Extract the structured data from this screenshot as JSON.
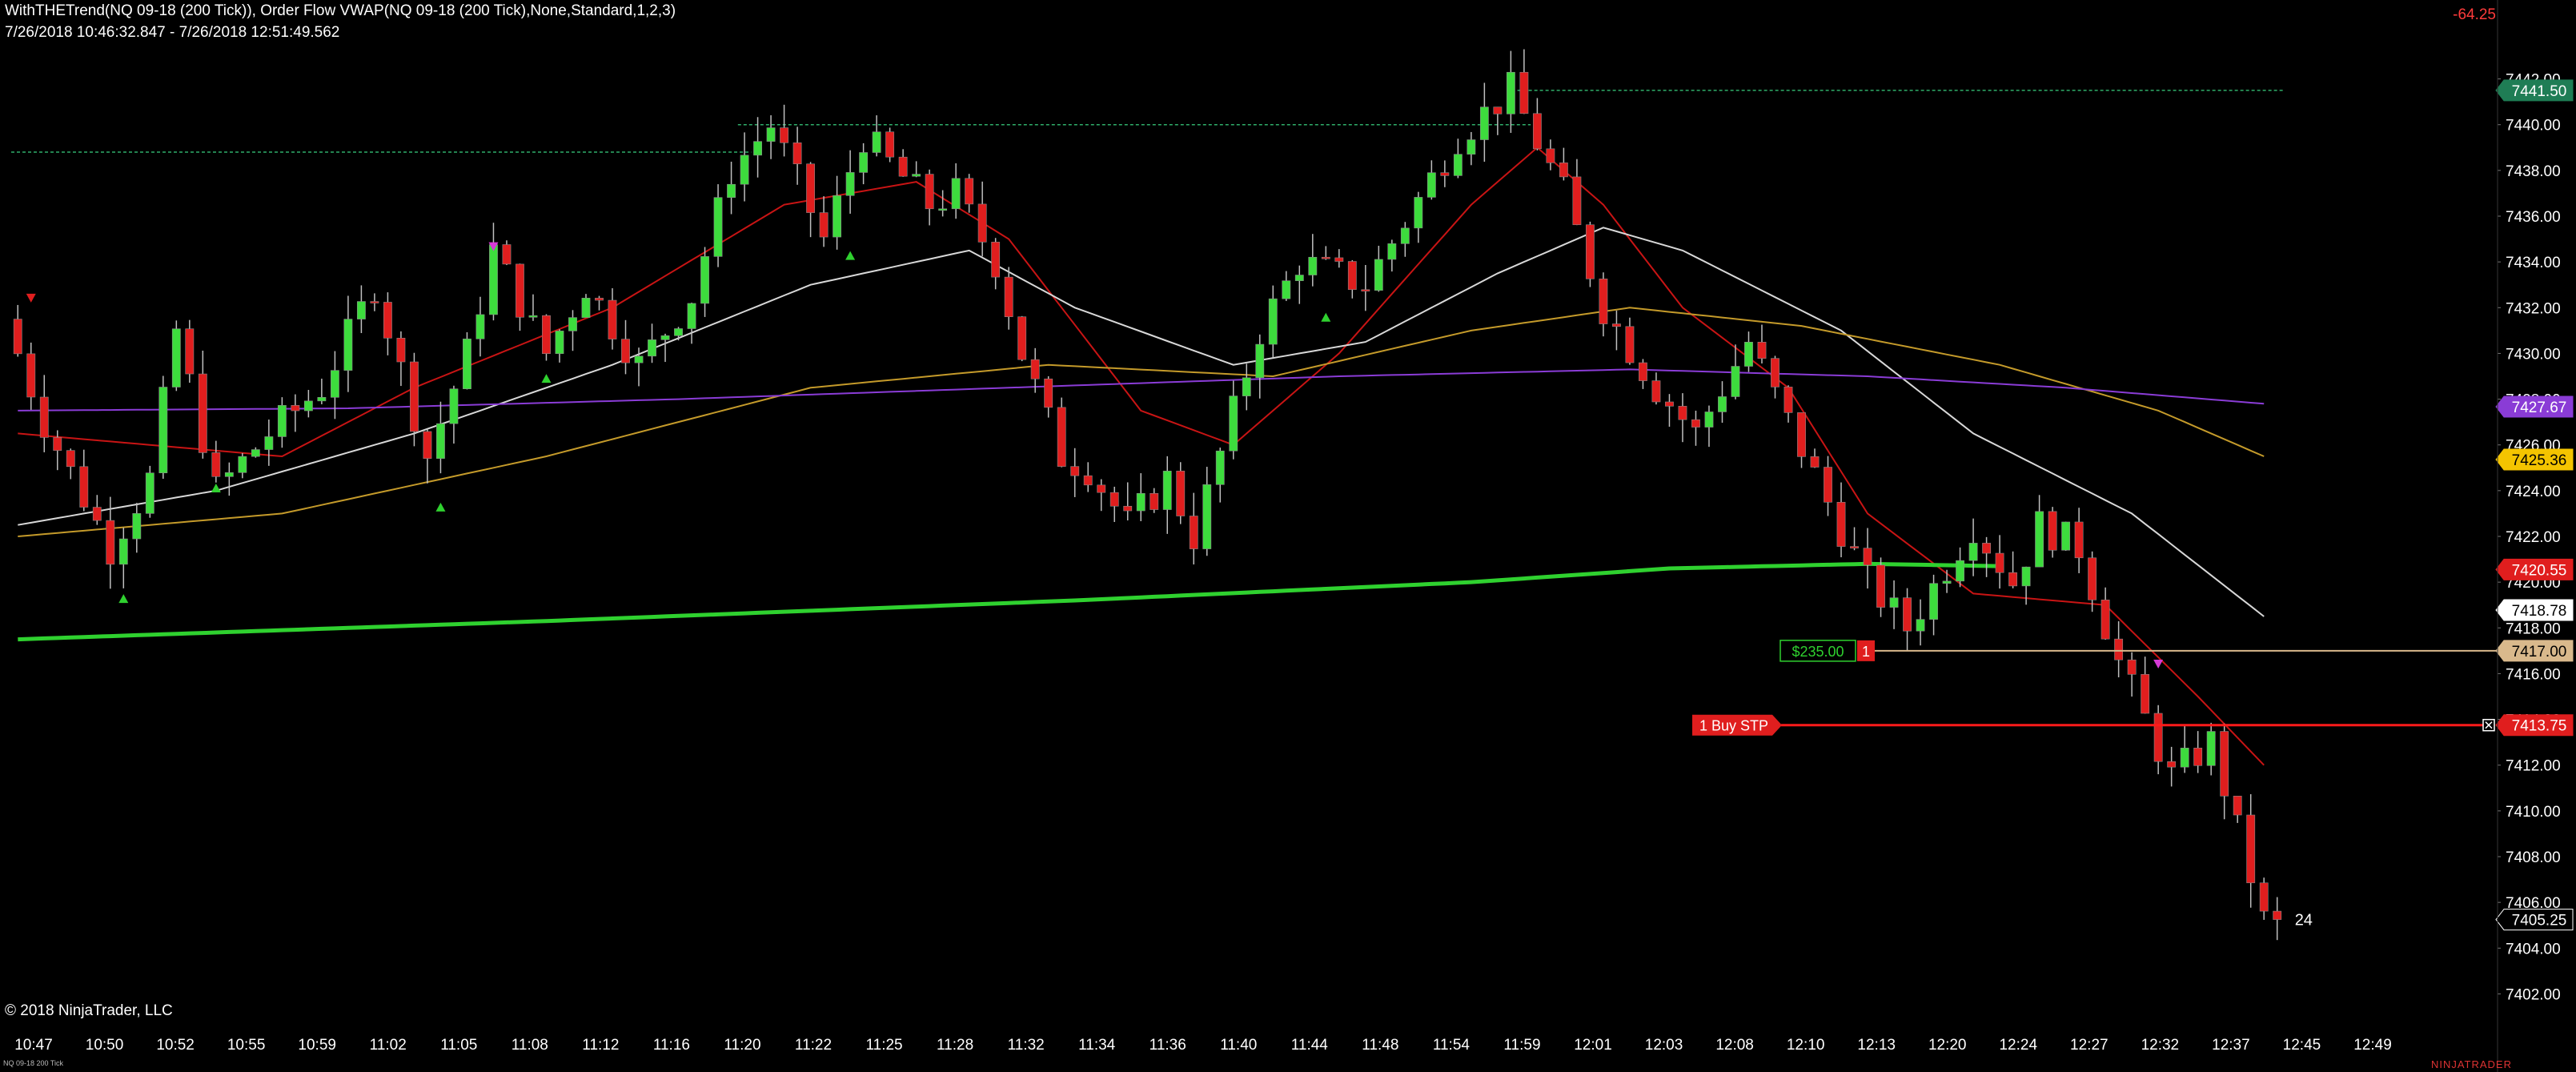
{
  "header": {
    "title": "WithTHETrend(NQ 09-18 (200 Tick)), Order Flow VWAP(NQ 09-18 (200 Tick),None,Standard,1,2,3)",
    "date_range": "7/26/2018 10:46:32.847 - 7/26/2018 12:51:49.562",
    "pnl": "-64.25"
  },
  "footer": {
    "copyright": "© 2018 NinjaTrader, LLC",
    "instrument_tag": "NQ 09-18 200 Tick",
    "brand": "NINJATRADER"
  },
  "colors": {
    "background": "#000000",
    "up_candle": "#3ddc3d",
    "down_candle": "#e01e1e",
    "ema_fast": "#c81414",
    "ema_mid": "#d8d8d8",
    "ema_slow": "#c49a2a",
    "sma_long": "#8a3cd6",
    "vwap": "#2fd12f",
    "position_line": "#d9b98c",
    "stop_line": "#ff1a1a"
  },
  "chart_data": {
    "type": "candlestick",
    "y_range": [
      7401,
      7443
    ],
    "y_ticks": [
      "7442.00",
      "7440.00",
      "7438.00",
      "7436.00",
      "7434.00",
      "7432.00",
      "7430.00",
      "7428.00",
      "7426.00",
      "7424.00",
      "7422.00",
      "7420.00",
      "7418.00",
      "7416.00",
      "7414.00",
      "7412.00",
      "7410.00",
      "7408.00",
      "7406.00",
      "7404.00",
      "7402.00"
    ],
    "x_labels": [
      "10:47",
      "10:50",
      "10:52",
      "10:55",
      "10:59",
      "11:02",
      "11:05",
      "11:08",
      "11:12",
      "11:16",
      "11:20",
      "11:22",
      "11:25",
      "11:28",
      "11:32",
      "11:34",
      "11:36",
      "11:40",
      "11:44",
      "11:48",
      "11:54",
      "11:59",
      "12:01",
      "12:03",
      "12:08",
      "12:10",
      "12:13",
      "12:20",
      "12:24",
      "12:27",
      "12:32",
      "12:37",
      "12:45",
      "12:49"
    ],
    "bar_count": 180,
    "waypoints": [
      [
        0,
        7431.5
      ],
      [
        3,
        7427.0
      ],
      [
        8,
        7421.5
      ],
      [
        11,
        7424.5
      ],
      [
        13,
        7431.0
      ],
      [
        16,
        7424.0
      ],
      [
        20,
        7426.5
      ],
      [
        24,
        7428.5
      ],
      [
        28,
        7433.0
      ],
      [
        32,
        7425.5
      ],
      [
        35,
        7430.0
      ],
      [
        37,
        7434.5
      ],
      [
        41,
        7430.0
      ],
      [
        44,
        7433.0
      ],
      [
        48,
        7429.5
      ],
      [
        52,
        7432.5
      ],
      [
        55,
        7438.0
      ],
      [
        58,
        7440.0
      ],
      [
        62,
        7435.0
      ],
      [
        65,
        7439.5
      ],
      [
        70,
        7436.5
      ],
      [
        72,
        7437.0
      ],
      [
        75,
        7434.0
      ],
      [
        77,
        7430.0
      ],
      [
        80,
        7425.5
      ],
      [
        82,
        7425.0
      ],
      [
        85,
        7422.5
      ],
      [
        88,
        7424.5
      ],
      [
        90,
        7422.0
      ],
      [
        95,
        7431.0
      ],
      [
        98,
        7434.0
      ],
      [
        103,
        7433.0
      ],
      [
        110,
        7439.5
      ],
      [
        114,
        7441.5
      ],
      [
        118,
        7437.0
      ],
      [
        121,
        7432.0
      ],
      [
        125,
        7428.5
      ],
      [
        128,
        7426.5
      ],
      [
        132,
        7430.5
      ],
      [
        135,
        7427.0
      ],
      [
        138,
        7423.5
      ],
      [
        141,
        7420.0
      ],
      [
        144,
        7418.0
      ],
      [
        149,
        7422.5
      ],
      [
        152,
        7420.0
      ],
      [
        154,
        7422.5
      ],
      [
        157,
        7421.5
      ],
      [
        160,
        7416.5
      ],
      [
        164,
        7411.5
      ],
      [
        167,
        7413.0
      ],
      [
        171,
        7405.2
      ]
    ],
    "series": [
      {
        "name": "EMA fast",
        "color": "#c81414",
        "points": [
          [
            0,
            7426.5
          ],
          [
            20,
            7425.5
          ],
          [
            30,
            7428.5
          ],
          [
            45,
            7432.0
          ],
          [
            58,
            7436.5
          ],
          [
            68,
            7437.5
          ],
          [
            75,
            7435.0
          ],
          [
            85,
            7427.5
          ],
          [
            92,
            7426.0
          ],
          [
            100,
            7430.0
          ],
          [
            110,
            7436.5
          ],
          [
            115,
            7439.0
          ],
          [
            120,
            7436.5
          ],
          [
            126,
            7432.0
          ],
          [
            134,
            7428.5
          ],
          [
            140,
            7423.0
          ],
          [
            148,
            7419.5
          ],
          [
            158,
            7419.0
          ],
          [
            165,
            7415.0
          ],
          [
            170,
            7412.0
          ]
        ]
      },
      {
        "name": "EMA mid",
        "color": "#d8d8d8",
        "points": [
          [
            0,
            7422.5
          ],
          [
            15,
            7424.0
          ],
          [
            30,
            7426.5
          ],
          [
            45,
            7429.5
          ],
          [
            60,
            7433.0
          ],
          [
            72,
            7434.5
          ],
          [
            80,
            7432.0
          ],
          [
            92,
            7429.5
          ],
          [
            102,
            7430.5
          ],
          [
            112,
            7433.5
          ],
          [
            120,
            7435.5
          ],
          [
            126,
            7434.5
          ],
          [
            138,
            7431.0
          ],
          [
            148,
            7426.5
          ],
          [
            160,
            7423.0
          ],
          [
            170,
            7418.5
          ]
        ]
      },
      {
        "name": "EMA slow",
        "color": "#c49a2a",
        "points": [
          [
            0,
            7422.0
          ],
          [
            20,
            7423.0
          ],
          [
            40,
            7425.5
          ],
          [
            60,
            7428.5
          ],
          [
            78,
            7429.5
          ],
          [
            95,
            7429.0
          ],
          [
            110,
            7431.0
          ],
          [
            122,
            7432.0
          ],
          [
            135,
            7431.2
          ],
          [
            150,
            7429.5
          ],
          [
            162,
            7427.5
          ],
          [
            170,
            7425.5
          ]
        ]
      },
      {
        "name": "SMA long",
        "color": "#8a3cd6",
        "points": [
          [
            0,
            7427.5
          ],
          [
            25,
            7427.6
          ],
          [
            50,
            7428.0
          ],
          [
            75,
            7428.5
          ],
          [
            100,
            7429.0
          ],
          [
            122,
            7429.3
          ],
          [
            140,
            7429.0
          ],
          [
            155,
            7428.5
          ],
          [
            170,
            7427.8
          ]
        ]
      },
      {
        "name": "VWAP",
        "color": "#2fd12f",
        "points": [
          [
            0,
            7417.5
          ],
          [
            40,
            7418.3
          ],
          [
            80,
            7419.2
          ],
          [
            110,
            7420.0
          ],
          [
            125,
            7420.6
          ],
          [
            140,
            7420.8
          ],
          [
            150,
            7420.7
          ]
        ]
      }
    ],
    "horizontal_levels": [
      {
        "value": 7441.5,
        "from": 114,
        "to": 171,
        "style": "dashed",
        "color": "#2fae6a"
      },
      {
        "value": 7440.0,
        "from": 55,
        "to": 114,
        "style": "dashed",
        "color": "#2fae6a"
      },
      {
        "value": 7438.8,
        "from": 0,
        "to": 55,
        "style": "dashed",
        "color": "#2fae6a"
      }
    ],
    "price_markers": [
      {
        "label": "7441.50",
        "value": 7441.5,
        "bg": "#1f7d55",
        "fg": "#ffffff"
      },
      {
        "label": "7427.67",
        "value": 7427.67,
        "bg": "#8a3cd6",
        "fg": "#ffffff"
      },
      {
        "label": "7425.36",
        "value": 7425.36,
        "bg": "#f4c400",
        "fg": "#000000"
      },
      {
        "label": "7420.55",
        "value": 7420.55,
        "bg": "#e01e1e",
        "fg": "#ffffff"
      },
      {
        "label": "7418.78",
        "value": 7418.78,
        "bg": "#ffffff",
        "fg": "#000000"
      },
      {
        "label": "7417.00",
        "value": 7417.0,
        "bg": "#d9b98c",
        "fg": "#000000"
      },
      {
        "label": "7413.75",
        "value": 7413.75,
        "bg": "#e01e1e",
        "fg": "#ffffff"
      },
      {
        "label": "7405.25",
        "value": 7405.25,
        "bg": "#000000",
        "fg": "#ffffff"
      }
    ],
    "position": {
      "pnl_label": "$235.00",
      "qty": "1",
      "price": 7417.0
    },
    "order": {
      "label": "1 Buy STP",
      "price": 7413.75
    },
    "last_bar_countdown": "24",
    "signals_up": [
      8,
      15,
      32,
      40,
      63,
      99
    ],
    "signals_down": [
      1,
      36,
      162
    ]
  }
}
